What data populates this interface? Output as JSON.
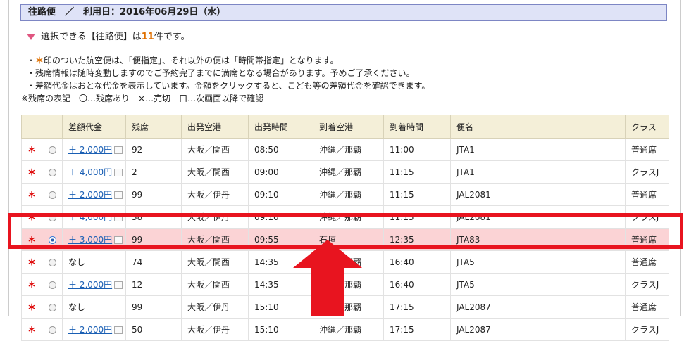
{
  "header": {
    "title": "往路便　／　利用日：2016年06月29日（水）"
  },
  "count": {
    "prefix": "選択できる【往路便】は",
    "number": "11",
    "suffix": "件です。"
  },
  "notes": {
    "n1_pre": "・",
    "n1_mark": "＊",
    "n1_text": "印のついた航空便は、「便指定」、それ以外の便は「時間帯指定」となります。",
    "n2": "・残席情報は随時変動しますのでご予約完了までに満席となる場合があります。予めご了承ください。",
    "n3": "・差額代金はおとな代金を表示しています。金額をクリックすると、こども等の差額代金を確認できます。",
    "legend": "※残席の表記　〇…残席あり　×…売切　口…次画面以降で確認"
  },
  "table": {
    "headers": [
      "",
      "",
      "差額代金",
      "残席",
      "出発空港",
      "出発時間",
      "到着空港",
      "到着時間",
      "便名",
      "クラス"
    ],
    "rows": [
      {
        "mark": "＊",
        "price": "＋ 2,000円",
        "seats": "92",
        "dep": "大阪／関西",
        "dtime": "08:50",
        "arr": "沖縄／那覇",
        "atime": "11:00",
        "flight": "JTA1",
        "cls": "普通席"
      },
      {
        "mark": "＊",
        "price": "＋ 4,000円",
        "seats": "2",
        "dep": "大阪／関西",
        "dtime": "09:00",
        "arr": "沖縄／那覇",
        "atime": "11:15",
        "flight": "JTA1",
        "cls": "クラスJ"
      },
      {
        "mark": "＊",
        "price": "＋ 2,000円",
        "seats": "99",
        "dep": "大阪／伊丹",
        "dtime": "09:10",
        "arr": "沖縄／那覇",
        "atime": "11:15",
        "flight": "JAL2081",
        "cls": "普通席"
      },
      {
        "mark": "＊",
        "price": "＋ 4,000円",
        "seats": "38",
        "dep": "大阪／伊丹",
        "dtime": "09:10",
        "arr": "沖縄／那覇",
        "atime": "11:15",
        "flight": "JAL2081",
        "cls": "クラスJ"
      },
      {
        "mark": "＊",
        "price": "＋ 3,000円",
        "seats": "99",
        "dep": "大阪／関西",
        "dtime": "09:55",
        "arr": "石垣",
        "atime": "12:35",
        "flight": "JTA83",
        "cls": "普通席"
      },
      {
        "mark": "＊",
        "price": "なし",
        "seats": "74",
        "dep": "大阪／関西",
        "dtime": "14:35",
        "arr": "沖縄／那覇",
        "atime": "16:40",
        "flight": "JTA5",
        "cls": "普通席"
      },
      {
        "mark": "＊",
        "price": "＋ 2,000円",
        "seats": "12",
        "dep": "大阪／関西",
        "dtime": "14:35",
        "arr": "沖縄／那覇",
        "atime": "16:40",
        "flight": "JTA5",
        "cls": "クラスJ"
      },
      {
        "mark": "＊",
        "price": "なし",
        "seats": "99",
        "dep": "大阪／伊丹",
        "dtime": "15:10",
        "arr": "沖縄／那覇",
        "atime": "17:15",
        "flight": "JAL2087",
        "cls": "普通席"
      },
      {
        "mark": "＊",
        "price": "＋ 2,000円",
        "seats": "50",
        "dep": "大阪／伊丹",
        "dtime": "15:10",
        "arr": "沖縄／那覇",
        "atime": "17:15",
        "flight": "JAL2087",
        "cls": "クラスJ"
      }
    ]
  },
  "colors": {
    "highlight_row": "#fbd3d5",
    "annotation": "#e8141f",
    "accent": "#e07000",
    "link": "#1a5fb4"
  }
}
